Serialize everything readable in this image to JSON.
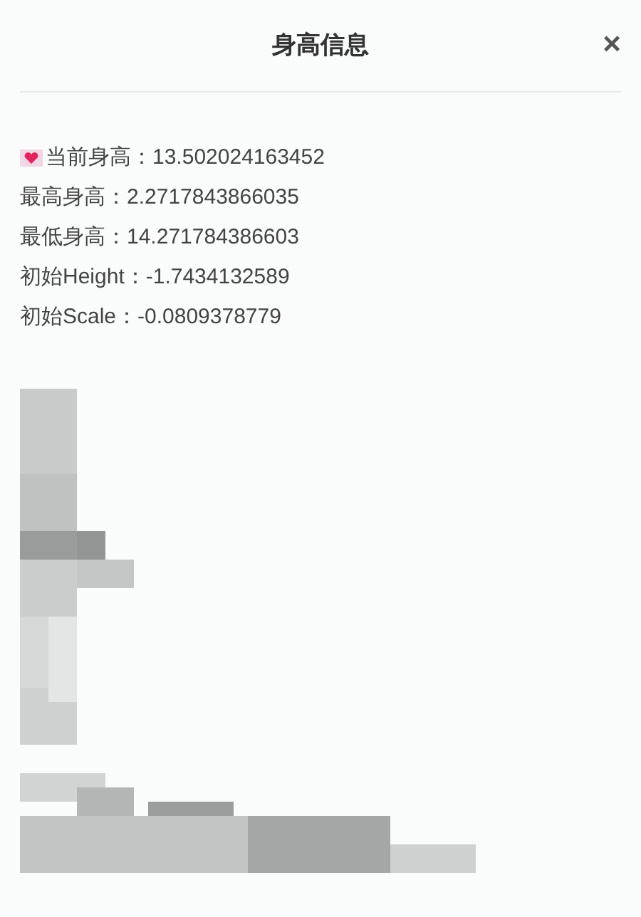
{
  "dialog": {
    "title": "身高信息",
    "close": "×"
  },
  "lines": [
    {
      "kind": "heart",
      "text": "当前身高：13.502024163452"
    },
    {
      "kind": "plain",
      "text": "最高身高：2.2717843866035"
    },
    {
      "kind": "plain",
      "text": "最低身高：14.271784386603"
    },
    {
      "kind": "plain",
      "text": "初始Height：-1.7434132589"
    },
    {
      "kind": "plain",
      "text": "初始Scale：-0.0809378779"
    }
  ]
}
